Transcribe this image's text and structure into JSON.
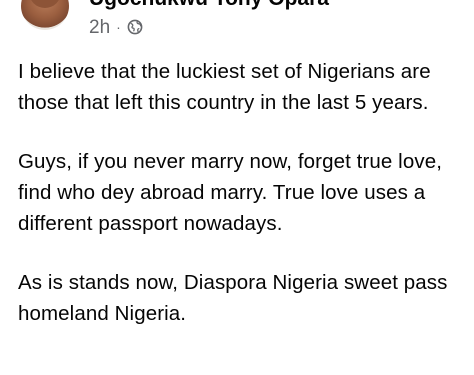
{
  "post": {
    "author_name": "Ugochukwu Tony Opara",
    "timestamp": "2h",
    "separator": "·",
    "audience_icon": "globe-icon",
    "paragraphs": [
      "I believe that the luckiest set of Nigerians are those that left this country in the last 5 years.",
      "Guys, if you never marry now, forget true love, find who dey abroad marry. True love uses a different passport nowadays.",
      "As is stands now, Diaspora Nigeria sweet pass homeland Nigeria."
    ]
  },
  "colors": {
    "text": "#050505",
    "meta_text": "#65676b",
    "background": "#ffffff"
  }
}
